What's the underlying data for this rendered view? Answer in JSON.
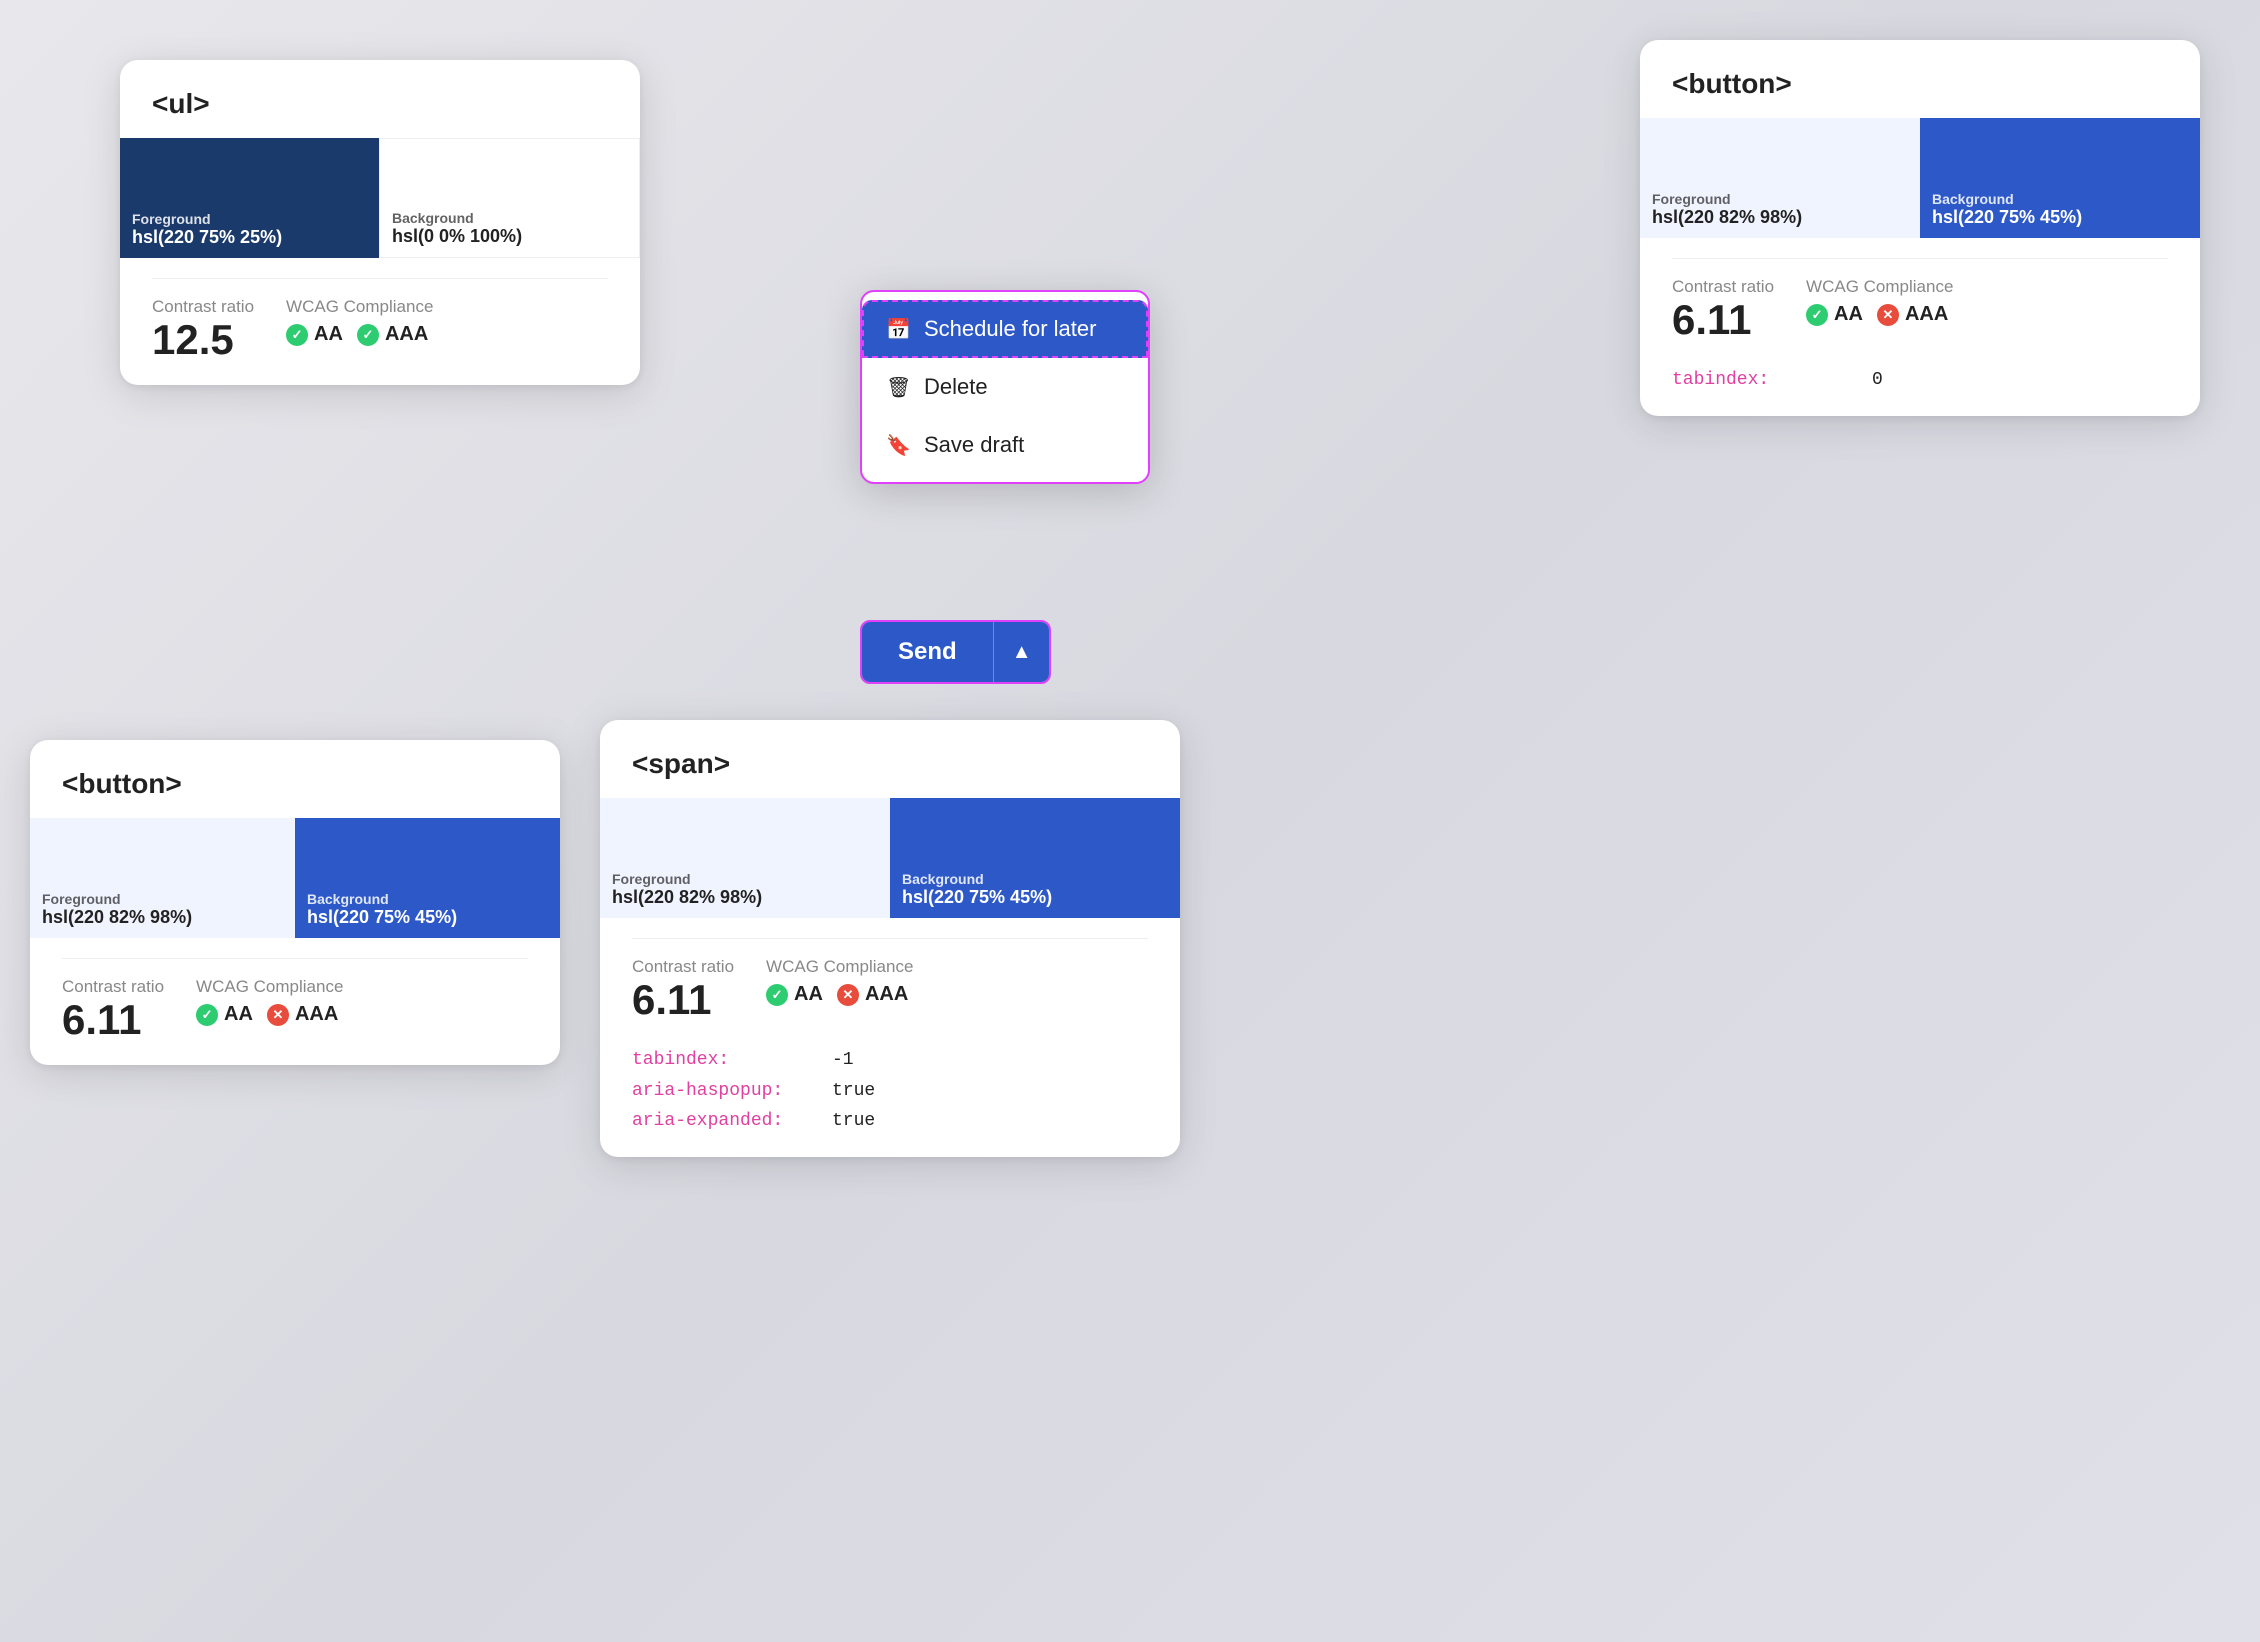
{
  "cards": {
    "ul_card": {
      "tag": "<ul>",
      "swatch_left_color": "#1a3a6b",
      "swatch_right_color": "#ffffff",
      "foreground_label": "Foreground",
      "foreground_value": "hsl(220 75% 25%)",
      "background_label": "Background",
      "background_value": "hsl(0 0% 100%)",
      "contrast_label": "Contrast ratio",
      "contrast_value": "12.5",
      "wcag_label": "WCAG Compliance",
      "aa_label": "AA",
      "aaa_label": "AAA"
    },
    "button_top_card": {
      "tag": "<button>",
      "swatch_left_color": "#f0f4ff",
      "swatch_right_color": "#2d59c8",
      "foreground_label": "Foreground",
      "foreground_value": "hsl(220 82% 98%)",
      "background_label": "Background",
      "background_value": "hsl(220 75% 45%)",
      "contrast_label": "Contrast ratio",
      "contrast_value": "6.11",
      "wcag_label": "WCAG Compliance",
      "aa_label": "AA",
      "aaa_label": "AAA",
      "attr_key": "tabindex:",
      "attr_val": "0"
    },
    "button_bottom_card": {
      "tag": "<button>",
      "swatch_left_color": "#f0f4ff",
      "swatch_right_color": "#2d59c8",
      "foreground_label": "Foreground",
      "foreground_value": "hsl(220 82% 98%)",
      "background_label": "Background",
      "background_value": "hsl(220 75% 45%)",
      "contrast_label": "Contrast ratio",
      "contrast_value": "6.11",
      "wcag_label": "WCAG Compliance",
      "aa_label": "AA",
      "aaa_label": "AAA"
    },
    "span_card": {
      "tag": "<span>",
      "swatch_left_color": "#f0f4ff",
      "swatch_right_color": "#2d59c8",
      "foreground_label": "Foreground",
      "foreground_value": "hsl(220 82% 98%)",
      "background_label": "Background",
      "background_value": "hsl(220 75% 45%)",
      "contrast_label": "Contrast ratio",
      "contrast_value": "6.11",
      "wcag_label": "WCAG Compliance",
      "aa_label": "AA",
      "aaa_label": "AAA",
      "attrs": [
        {
          "key": "tabindex:",
          "val": "-1"
        },
        {
          "key": "aria-haspopup:",
          "val": "true"
        },
        {
          "key": "aria-expanded:",
          "val": "true"
        }
      ]
    }
  },
  "dropdown": {
    "items": [
      {
        "id": "schedule",
        "label": "Schedule for later",
        "icon": "📅"
      },
      {
        "id": "delete",
        "label": "Delete",
        "icon": "🗑"
      },
      {
        "id": "save_draft",
        "label": "Save draft",
        "icon": "🔖"
      }
    ]
  },
  "send_button": {
    "main_label": "Send",
    "chevron": "▲"
  }
}
